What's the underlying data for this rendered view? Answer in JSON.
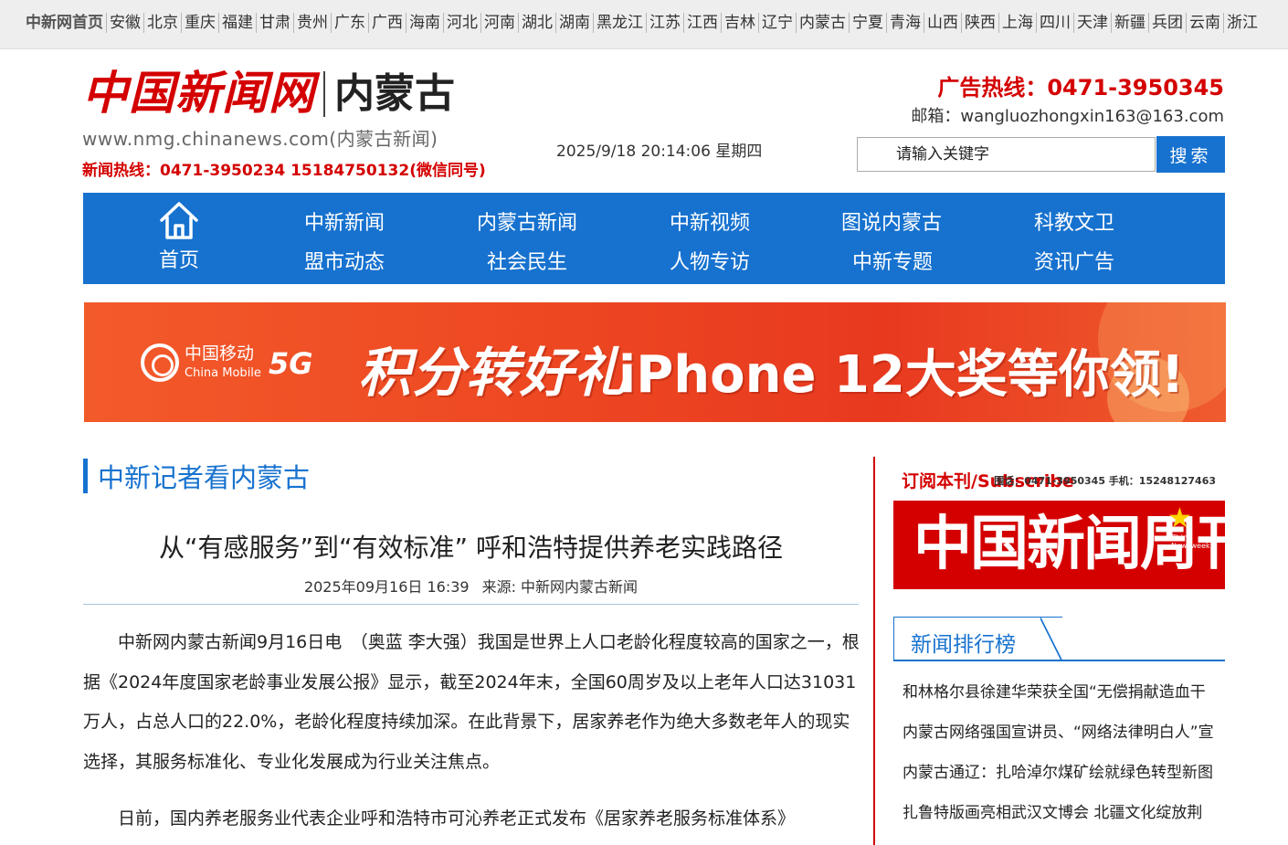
{
  "topbar": {
    "home": "中新网首页",
    "provinces": [
      "安徽",
      "北京",
      "重庆",
      "福建",
      "甘肃",
      "贵州",
      "广东",
      "广西",
      "海南",
      "河北",
      "河南",
      "湖北",
      "湖南",
      "黑龙江",
      "江苏",
      "江西",
      "吉林",
      "辽宁",
      "内蒙古",
      "宁夏",
      "青海",
      "山西",
      "陕西",
      "上海",
      "四川",
      "天津",
      "新疆",
      "兵团",
      "云南",
      "浙江"
    ]
  },
  "header": {
    "logo_name": "中国新闻网",
    "logo_region": "内蒙古",
    "url": "www.nmg.chinanews.com(内蒙古新闻)",
    "news_hotline": "新闻热线：0471-3950234 15184750132(微信同号)",
    "datetime": "2025/9/18 20:14:06 星期四",
    "ad_hotline": "广告热线：0471-3950345",
    "email": "邮箱：wangluozhongxin163@163.com"
  },
  "search": {
    "placeholder": "请输入关键字",
    "button": "搜索"
  },
  "nav": {
    "home": "首页",
    "row1": [
      "中新新闻",
      "内蒙古新闻",
      "中新视频",
      "图说内蒙古",
      "科教文卫"
    ],
    "row2": [
      "盟市动态",
      "社会民生",
      "人物专访",
      "中新专题",
      "资讯广告"
    ]
  },
  "banner": {
    "brand_cn": "中国移动",
    "brand_en": "China Mobile",
    "fiveg": "5G",
    "slogan": "积分转好礼",
    "prize": "iPhone 12大奖等你领!"
  },
  "section": {
    "title": "中新记者看内蒙古"
  },
  "article": {
    "title": "从“有感服务”到“有效标准” 呼和浩特提供养老实践路径",
    "date": "2025年09月16日 16:39",
    "source": "来源: 中新网内蒙古新闻",
    "paragraphs": [
      "中新网内蒙古新闻9月16日电　（奥蓝 李大强）我国是世界上人口老龄化程度较高的国家之一，根据《2024年度国家老龄事业发展公报》显示，截至2024年末，全国60周岁及以上老年人口达31031万人，占总人口的22.0%，老龄化程度持续加深。在此背景下，居家养老作为绝大多数老年人的现实选择，其服务标准化、专业化发展成为行业关注焦点。",
      "日前，国内养老服务业代表企业呼和浩特市可沁养老正式发布《居家养老服务标准体系》"
    ]
  },
  "sidebar": {
    "subscribe_title": "订阅本刊/Subscribe",
    "subscribe_info": "围话：0471-3950345 手机：15248127463",
    "weekly_name": "中国新闻周刊",
    "weekly_en": "China Newsweek",
    "rank_title": "新闻排行榜",
    "rank_items": [
      "和林格尔县徐建华荣获全国“无偿捐献造血干",
      "内蒙古网络强国宣讲员、“网络法律明白人”宣",
      "内蒙古通辽：扎哈淖尔煤矿绘就绿色转型新图",
      "扎鲁特版画亮相武汉文博会 北疆文化绽放荆"
    ]
  },
  "colors": {
    "brand_blue": "#1772cf",
    "brand_red": "#d40000",
    "banner_orange": "#ee4a23"
  }
}
